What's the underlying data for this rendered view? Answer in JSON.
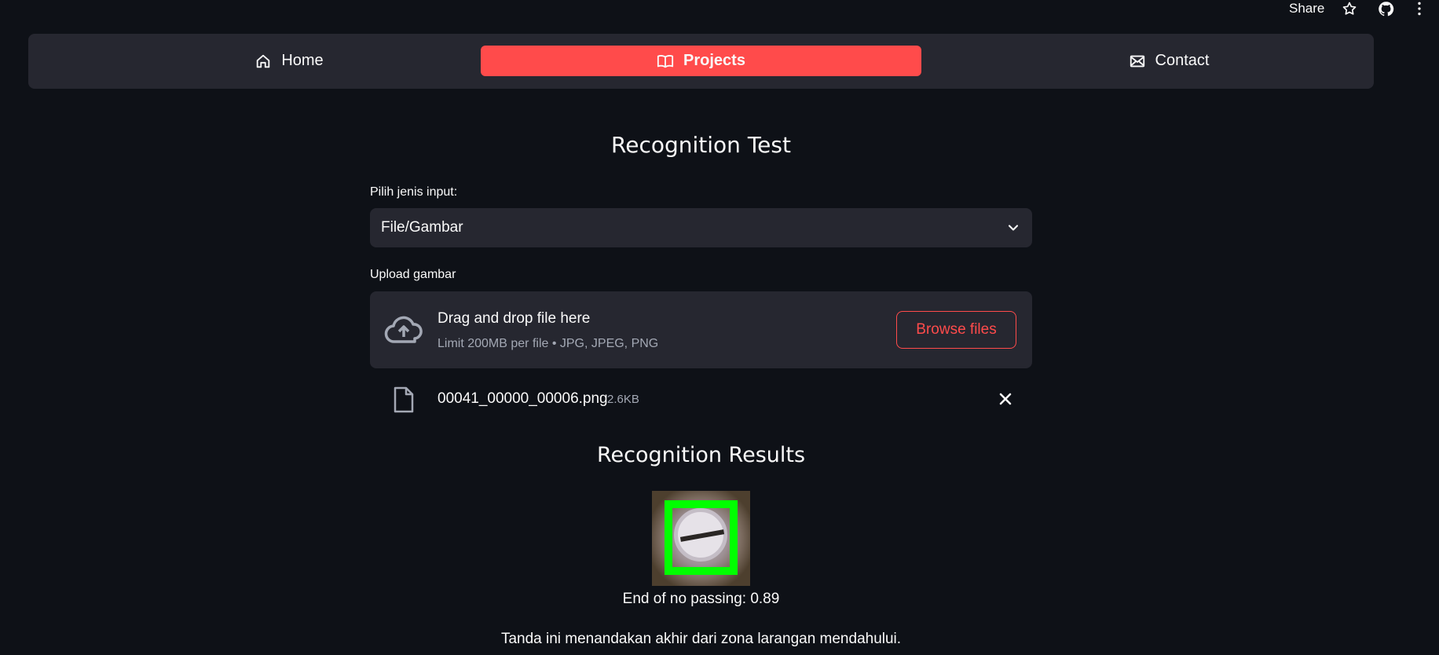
{
  "toolbar": {
    "share_label": "Share",
    "icons": [
      "star-icon",
      "github-icon",
      "more-vert-icon"
    ]
  },
  "nav": {
    "items": [
      {
        "label": "Home",
        "icon": "home-icon",
        "active": false
      },
      {
        "label": "Projects",
        "icon": "book-icon",
        "active": true
      },
      {
        "label": "Contact",
        "icon": "envelope-icon",
        "active": false
      }
    ],
    "accent": "#ff4b4b"
  },
  "page": {
    "title": "Recognition Test",
    "input_type": {
      "label": "Pilih jenis input:",
      "selected": "File/Gambar"
    },
    "upload": {
      "label": "Upload gambar",
      "dropzone_title": "Drag and drop file here",
      "dropzone_subtitle": "Limit 200MB per file • JPG, JPEG, PNG",
      "browse_label": "Browse files"
    },
    "uploaded_file": {
      "name": "00041_00000_00006.png",
      "size": "2.6KB"
    },
    "results": {
      "title": "Recognition Results",
      "prediction": "End of no passing: 0.89",
      "description": "Tanda ini menandakan akhir dari zona larangan mendahului.",
      "box_color": "#00ff00"
    }
  }
}
